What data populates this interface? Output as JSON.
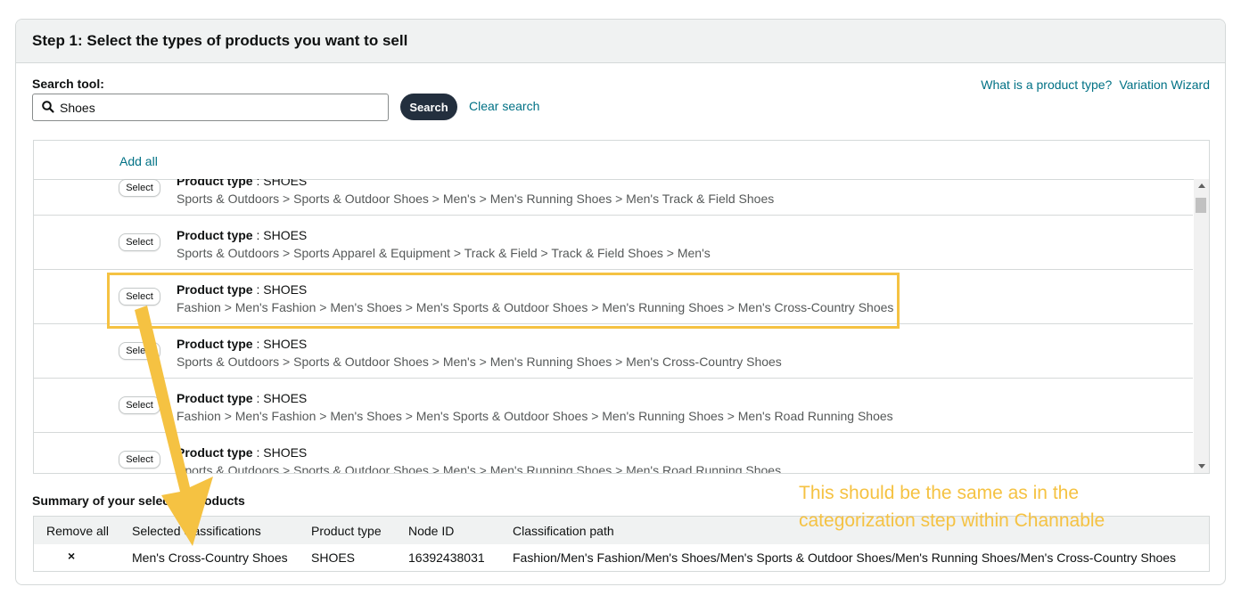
{
  "step_title": "Step 1: Select the types of products you want to sell",
  "search": {
    "label": "Search tool:",
    "value": "Shoes",
    "button_label": "Search",
    "clear_label": "Clear search"
  },
  "top_links": {
    "what_is": "What is a product type?",
    "variation_wizard": "Variation Wizard"
  },
  "list": {
    "add_all_label": "Add all",
    "select_label": "Select",
    "type_prefix": "Product type",
    "rows": [
      {
        "type": "SHOES",
        "path": "Sports & Outdoors > Sports & Outdoor Shoes > Men's > Men's Running Shoes > Men's Track & Field Shoes"
      },
      {
        "type": "SHOES",
        "path": "Sports & Outdoors > Sports Apparel & Equipment > Track & Field > Track & Field Shoes > Men's"
      },
      {
        "type": "SHOES",
        "path": "Fashion > Men's Fashion > Men's Shoes > Men's Sports & Outdoor Shoes > Men's Running Shoes > Men's Cross-Country Shoes"
      },
      {
        "type": "SHOES",
        "path": "Sports & Outdoors > Sports & Outdoor Shoes > Men's > Men's Running Shoes > Men's Cross-Country Shoes"
      },
      {
        "type": "SHOES",
        "path": "Fashion > Men's Fashion > Men's Shoes > Men's Sports & Outdoor Shoes > Men's Running Shoes > Men's Road Running Shoes"
      },
      {
        "type": "SHOES",
        "path": "Sports & Outdoors > Sports & Outdoor Shoes > Men's > Men's Running Shoes > Men's Road Running Shoes"
      }
    ]
  },
  "summary": {
    "label": "Summary of your selected products",
    "columns": {
      "remove_all": "Remove all",
      "selected": "Selected classifications",
      "product_type": "Product type",
      "node_id": "Node ID",
      "path": "Classification path"
    },
    "row": {
      "remove_icon": "×",
      "selected": "Men's Cross-Country Shoes",
      "product_type": "SHOES",
      "node_id": "16392438031",
      "path": "Fashion/Men's Fashion/Men's Shoes/Men's Sports & Outdoor Shoes/Men's Running Shoes/Men's Cross-Country Shoes"
    }
  },
  "annotation": {
    "note_line1": "This should be the same as in the",
    "note_line2": "categorization step within Channable",
    "color": "#f5c242"
  },
  "icons": {
    "search": "search-icon",
    "remove": "close-icon",
    "scroll_up": "chevron-up-icon",
    "scroll_down": "chevron-down-icon"
  }
}
